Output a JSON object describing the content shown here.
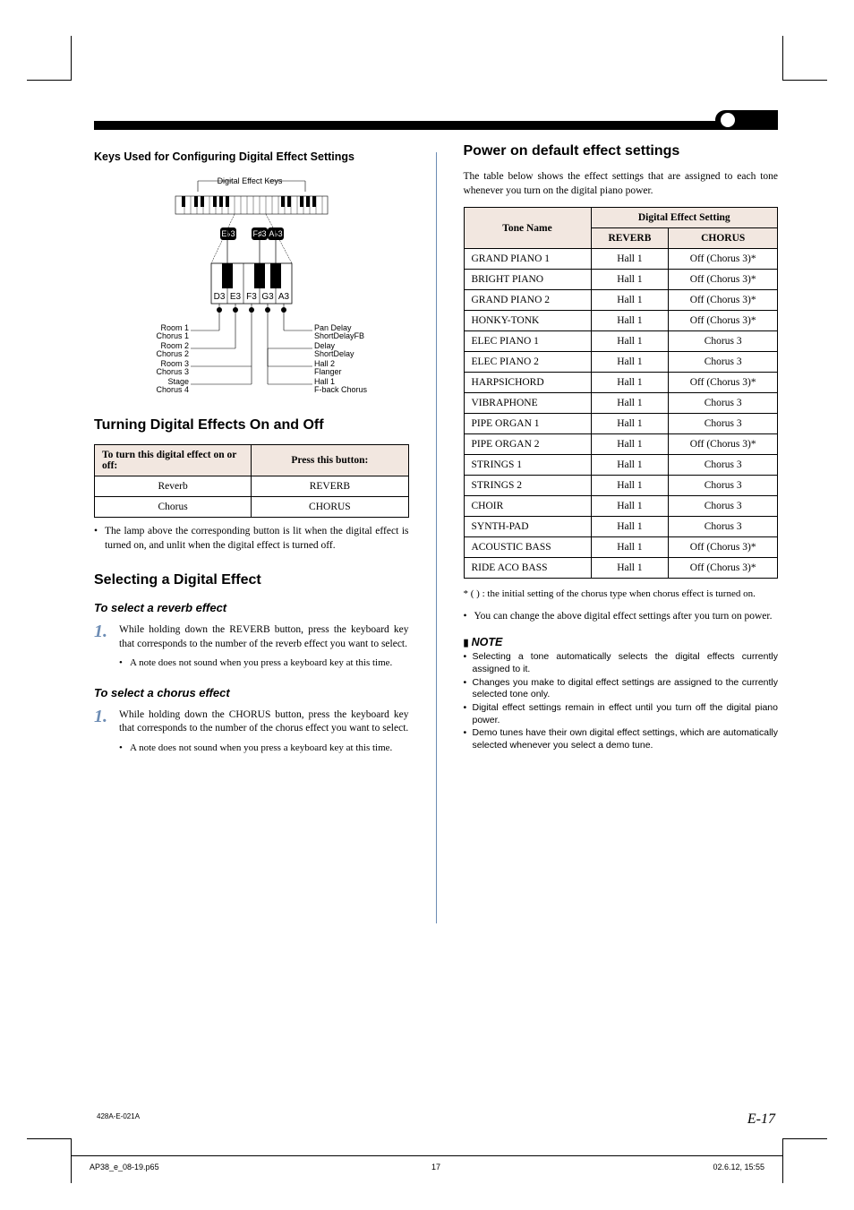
{
  "header": {
    "left_label": "Keys Used for Configuring Digital Effect Settings"
  },
  "diagram": {
    "bracket_label": "Digital Effect Keys",
    "black_keys": [
      "E♭3",
      "F♯3",
      "A♭3"
    ],
    "white_keys": [
      "D3",
      "E3",
      "F3",
      "G3",
      "A3"
    ],
    "left_labels": [
      "Room 1",
      "Chorus 1",
      "Room 2",
      "Chorus 2",
      "Room 3",
      "Chorus 3",
      "Stage",
      "Chorus 4"
    ],
    "right_labels": [
      "Pan Delay",
      "ShortDelayFB",
      "Delay",
      "ShortDelay",
      "Hall 2",
      "Flanger",
      "Hall 1",
      "F-back Chorus"
    ]
  },
  "left": {
    "h_onoff": "Turning Digital Effects On and Off",
    "tbl_onoff_hdr1": "To turn this digital effect on or off:",
    "tbl_onoff_hdr2": "Press this button:",
    "tbl_onoff_rows": [
      {
        "a": "Reverb",
        "b": "REVERB"
      },
      {
        "a": "Chorus",
        "b": "CHORUS"
      }
    ],
    "onoff_note": "The lamp above the corresponding button is lit when the digital effect is turned on, and unlit when the digital effect is turned off.",
    "h_select": "Selecting a Digital Effect",
    "sub_reverb": "To select a reverb effect",
    "step_reverb": "While holding down the REVERB button, press the keyboard key that corresponds to the number of the reverb effect you want to select.",
    "step_sub": "A note does not sound when you press a keyboard key at this time.",
    "sub_chorus": "To select a chorus effect",
    "step_chorus": "While holding down the CHORUS button, press the keyboard key that corresponds to the number of the chorus effect you want to select."
  },
  "right": {
    "h_defaults": "Power on default effect settings",
    "intro": "The table below shows the effect settings that are assigned to each tone whenever you turn on the digital piano power.",
    "tbl_hdr_tone": "Tone Name",
    "tbl_hdr_setting": "Digital Effect Setting",
    "tbl_hdr_reverb": "REVERB",
    "tbl_hdr_chorus": "CHORUS",
    "rows": [
      {
        "t": "GRAND PIANO 1",
        "r": "Hall 1",
        "c": "Off (Chorus 3)*"
      },
      {
        "t": "BRIGHT PIANO",
        "r": "Hall 1",
        "c": "Off (Chorus 3)*"
      },
      {
        "t": "GRAND PIANO 2",
        "r": "Hall 1",
        "c": "Off (Chorus 3)*"
      },
      {
        "t": "HONKY-TONK",
        "r": "Hall 1",
        "c": "Off (Chorus 3)*"
      },
      {
        "t": "ELEC PIANO 1",
        "r": "Hall 1",
        "c": "Chorus 3"
      },
      {
        "t": "ELEC PIANO 2",
        "r": "Hall 1",
        "c": "Chorus 3"
      },
      {
        "t": "HARPSICHORD",
        "r": "Hall 1",
        "c": "Off (Chorus 3)*"
      },
      {
        "t": "VIBRAPHONE",
        "r": "Hall 1",
        "c": "Chorus 3"
      },
      {
        "t": "PIPE ORGAN 1",
        "r": "Hall 1",
        "c": "Chorus 3"
      },
      {
        "t": "PIPE ORGAN 2",
        "r": "Hall 1",
        "c": "Off (Chorus 3)*"
      },
      {
        "t": "STRINGS 1",
        "r": "Hall 1",
        "c": "Chorus 3"
      },
      {
        "t": "STRINGS 2",
        "r": "Hall 1",
        "c": "Chorus 3"
      },
      {
        "t": "CHOIR",
        "r": "Hall 1",
        "c": "Chorus 3"
      },
      {
        "t": "SYNTH-PAD",
        "r": "Hall 1",
        "c": "Chorus 3"
      },
      {
        "t": "ACOUSTIC BASS",
        "r": "Hall 1",
        "c": "Off (Chorus 3)*"
      },
      {
        "t": "RIDE ACO BASS",
        "r": "Hall 1",
        "c": "Off (Chorus 3)*"
      }
    ],
    "footnote": "* ( ) : the initial setting of the chorus type when chorus effect is turned on.",
    "after_note": "You can change the above digital effect settings after you turn on power.",
    "note_hdr": "NOTE",
    "notes": [
      "Selecting a tone automatically selects the digital effects currently assigned to it.",
      "Changes you make to digital effect settings are assigned to the currently selected tone only.",
      "Digital effect settings remain in effect until you turn off the digital piano power.",
      "Demo tunes have their own digital effect settings, which are automatically selected whenever you select a demo tune."
    ]
  },
  "footer": {
    "code": "428A-E-021A",
    "page": "E-17",
    "file": "AP38_e_08-19.p65",
    "pg": "17",
    "ts": "02.6.12, 15:55"
  }
}
